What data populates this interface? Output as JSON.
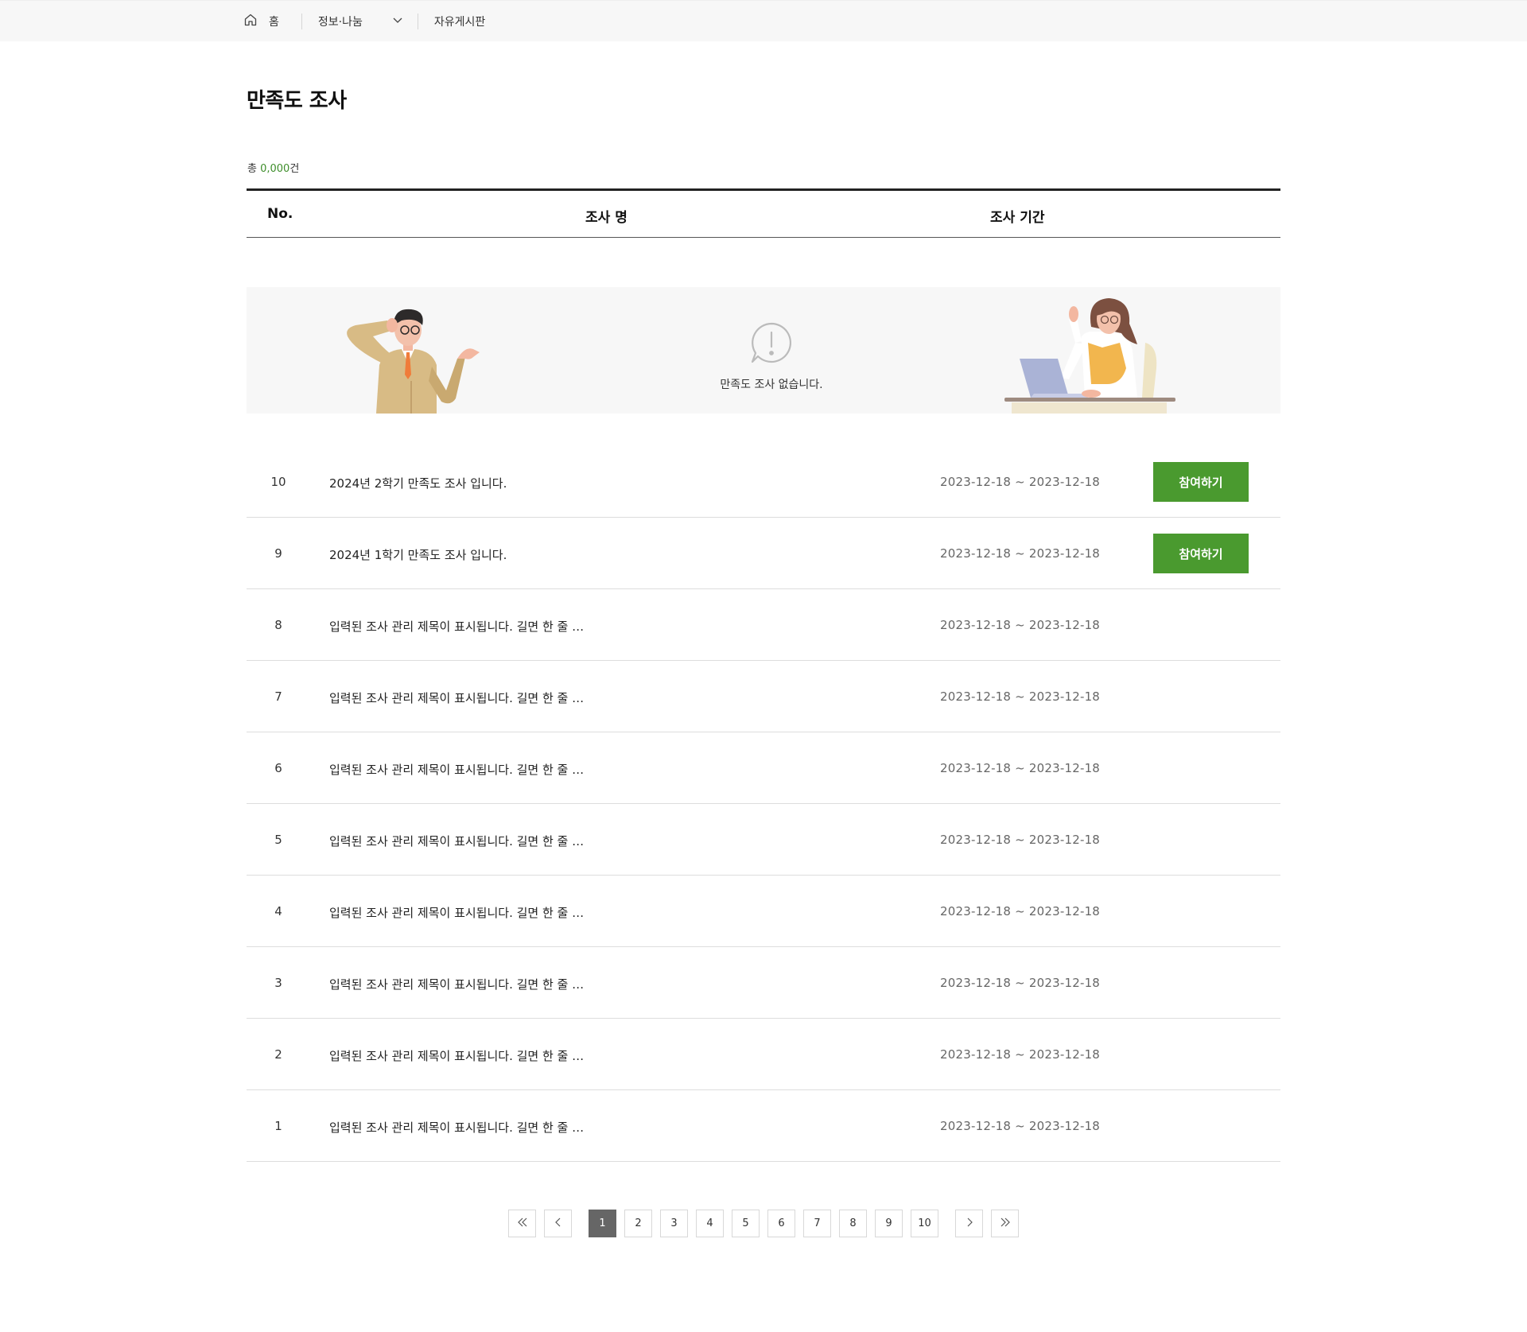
{
  "breadcrumb": {
    "home": "홈",
    "section": "정보·나눔",
    "current": "자유게시판"
  },
  "page": {
    "title": "만족도 조사",
    "total_prefix": "총 ",
    "total_count": "0,000",
    "total_suffix": "건"
  },
  "table": {
    "headers": {
      "no": "No.",
      "name": "조사 명",
      "period": "조사 기간"
    }
  },
  "empty": {
    "message": "만족도 조사 없습니다."
  },
  "rows": [
    {
      "no": "10",
      "title": "2024년 2학기 만족도 조사 입니다.",
      "period": "2023-12-18 ~ 2023-12-18",
      "action": "참여하기"
    },
    {
      "no": "9",
      "title": "2024년 1학기 만족도 조사 입니다.",
      "period": "2023-12-18 ~ 2023-12-18",
      "action": "참여하기"
    },
    {
      "no": "8",
      "title": "입력된 조사 관리 제목이 표시됩니다. 길면 한 줄 …",
      "period": "2023-12-18 ~ 2023-12-18"
    },
    {
      "no": "7",
      "title": "입력된 조사 관리 제목이 표시됩니다. 길면 한 줄 …",
      "period": "2023-12-18 ~ 2023-12-18"
    },
    {
      "no": "6",
      "title": "입력된 조사 관리 제목이 표시됩니다. 길면 한 줄 …",
      "period": "2023-12-18 ~ 2023-12-18"
    },
    {
      "no": "5",
      "title": "입력된 조사 관리 제목이 표시됩니다. 길면 한 줄 …",
      "period": "2023-12-18 ~ 2023-12-18"
    },
    {
      "no": "4",
      "title": "입력된 조사 관리 제목이 표시됩니다. 길면 한 줄 …",
      "period": "2023-12-18 ~ 2023-12-18"
    },
    {
      "no": "3",
      "title": "입력된 조사 관리 제목이 표시됩니다. 길면 한 줄 …",
      "period": "2023-12-18 ~ 2023-12-18"
    },
    {
      "no": "2",
      "title": "입력된 조사 관리 제목이 표시됩니다. 길면 한 줄 …",
      "period": "2023-12-18 ~ 2023-12-18"
    },
    {
      "no": "1",
      "title": "입력된 조사 관리 제목이 표시됩니다. 길면 한 줄 …",
      "period": "2023-12-18 ~ 2023-12-18"
    }
  ],
  "pagination": {
    "pages": [
      "1",
      "2",
      "3",
      "4",
      "5",
      "6",
      "7",
      "8",
      "9",
      "10"
    ],
    "current": "1"
  },
  "colors": {
    "accent": "#4a9a2f",
    "count": "#3e8e2b",
    "active_page": "#666666"
  },
  "icons": {
    "home": "home-icon",
    "dropdown": "chevron-down-icon",
    "alert": "alert-speech-bubble-icon",
    "first": "double-chevron-left-icon",
    "prev": "chevron-left-icon",
    "next": "chevron-right-icon",
    "last": "double-chevron-right-icon"
  }
}
